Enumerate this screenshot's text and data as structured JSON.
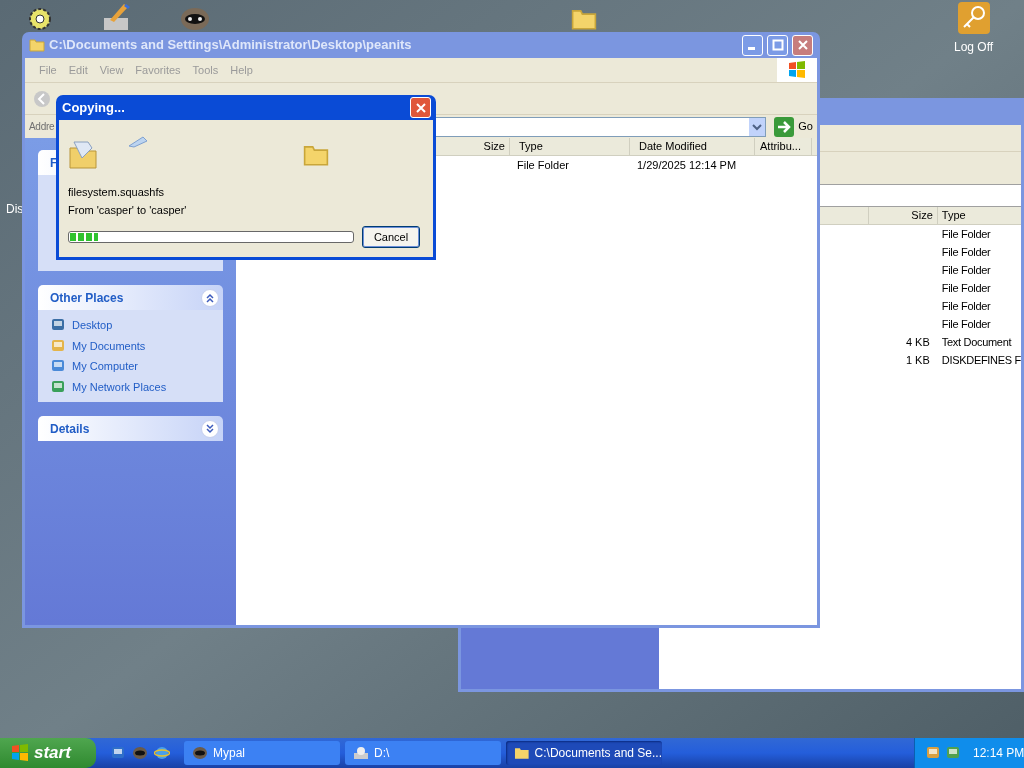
{
  "desktop": {
    "icons": [
      {
        "label": "Dis"
      },
      {
        "label": "Log Off"
      }
    ]
  },
  "back_window": {
    "columns": [
      "Size",
      "Type"
    ],
    "rows": [
      {
        "type": "File Folder"
      },
      {
        "type": "File Folder"
      },
      {
        "type": "File Folder"
      },
      {
        "type": "File Folder"
      },
      {
        "type": "File Folder"
      },
      {
        "type": "File Folder"
      },
      {
        "size": "4 KB",
        "type": "Text Document"
      },
      {
        "size": "1 KB",
        "type": "DISKDEFINES F"
      }
    ]
  },
  "explorer": {
    "title": "C:\\Documents and Settings\\Administrator\\Desktop\\peanits",
    "menu": [
      "File",
      "Edit",
      "View",
      "Favorites",
      "Tools",
      "Help"
    ],
    "address_label": "Addre",
    "go": "Go",
    "task_panels": [
      {
        "title": "F"
      },
      {
        "title": "Other Places",
        "expanded": true,
        "items": [
          "Desktop",
          "My Documents",
          "My Computer",
          "My Network Places"
        ]
      },
      {
        "title": "Details",
        "expanded": false
      }
    ],
    "columns": [
      "Size",
      "Type",
      "Date Modified",
      "Attribu..."
    ],
    "rows": [
      {
        "type": "File Folder",
        "date": "1/29/2025 12:14 PM"
      }
    ]
  },
  "dialog": {
    "title": "Copying...",
    "file": "filesystem.squashfs",
    "from_to": "From 'casper' to 'casper'",
    "level": 0.1,
    "cancel": "Cancel"
  },
  "taskbar": {
    "start": "start",
    "tasks": [
      {
        "label": "Mypal",
        "selected": false
      },
      {
        "label": "D:\\",
        "selected": false
      },
      {
        "label": "C:\\Documents and Se...",
        "selected": true
      }
    ],
    "clock": "12:14 PM"
  }
}
